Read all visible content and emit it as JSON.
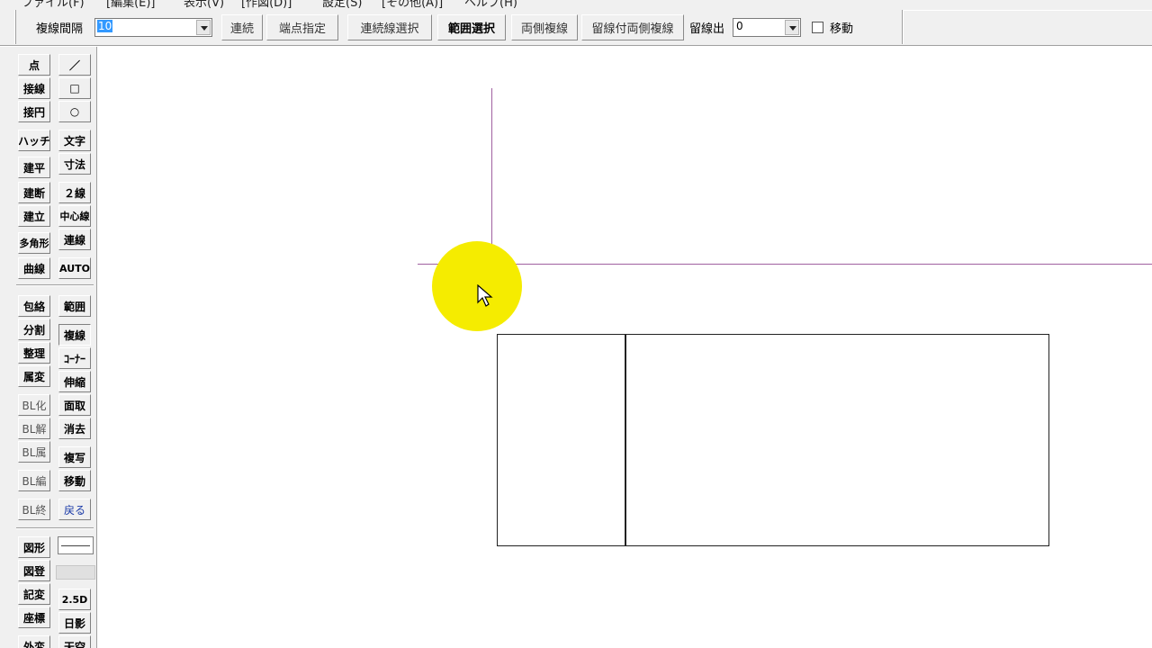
{
  "menubar": {
    "items": [
      "ファイル(F)",
      "[編集(E)]",
      "表示(V)",
      "[作図(D)]",
      "設定(S)",
      "[その他(A)]",
      "ヘルプ(H)"
    ]
  },
  "toolbar": {
    "spacing_label": "複線間隔",
    "spacing_value": "10",
    "buttons": {
      "continuous": "連続",
      "endpoint": "端点指定",
      "chain_select": "連続線選択",
      "range_select": "範囲選択",
      "both_sides": "両側複線",
      "stopped_both_sides": "留線付両側複線"
    },
    "stop_label": "留線出",
    "stop_value": "0",
    "move_label": "移動",
    "move_checked": false
  },
  "palette": {
    "left_col": [
      "点",
      "接線",
      "接円",
      "ハッチ",
      "建平",
      "建断",
      "建立",
      "多角形",
      "曲線",
      "包絡",
      "分割",
      "整理",
      "属変",
      "BL化",
      "BL解",
      "BL属",
      "BL編",
      "BL終",
      "図形",
      "図登",
      "記変",
      "座標",
      "外変"
    ],
    "right_col": [
      "／",
      "□",
      "○",
      "文字",
      "寸法",
      "２線",
      "中心線",
      "連線",
      "AUTO",
      "範囲",
      "複線",
      "ｺｰﾅｰ",
      "伸縮",
      "面取",
      "消去",
      "複写",
      "移動",
      "戻る",
      "2.5D",
      "日影",
      "天空"
    ]
  },
  "colors": {
    "crosshair": "#a060a0",
    "cursor_highlight": "#f5ec00",
    "face": "#f0f0f0"
  }
}
